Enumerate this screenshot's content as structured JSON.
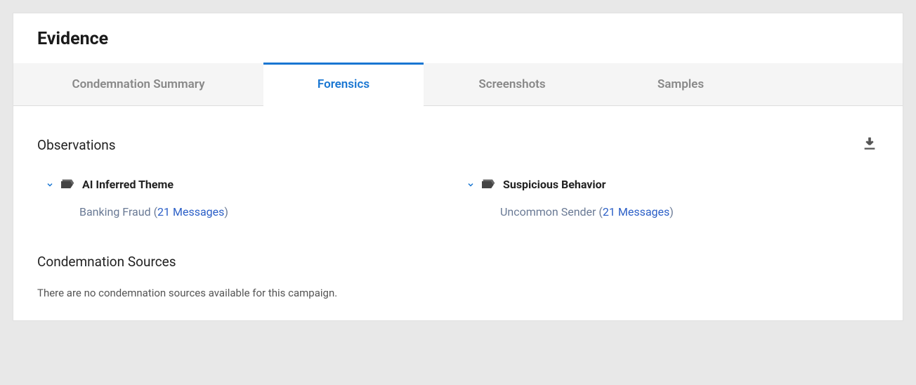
{
  "panel": {
    "title": "Evidence"
  },
  "tabs": {
    "items": [
      {
        "label": "Condemnation Summary",
        "active": false
      },
      {
        "label": "Forensics",
        "active": true
      },
      {
        "label": "Screenshots",
        "active": false
      },
      {
        "label": "Samples",
        "active": false
      }
    ]
  },
  "sections": {
    "observations": {
      "title": "Observations",
      "groups": [
        {
          "title": "AI Inferred Theme",
          "items": [
            {
              "label": "Banking Fraud",
              "count_label": "21 Messages"
            }
          ]
        },
        {
          "title": "Suspicious Behavior",
          "items": [
            {
              "label": "Uncommon Sender",
              "count_label": "21 Messages"
            }
          ]
        }
      ]
    },
    "condemnation_sources": {
      "title": "Condemnation Sources",
      "empty_text": "There are no condemnation sources available for this campaign."
    }
  }
}
